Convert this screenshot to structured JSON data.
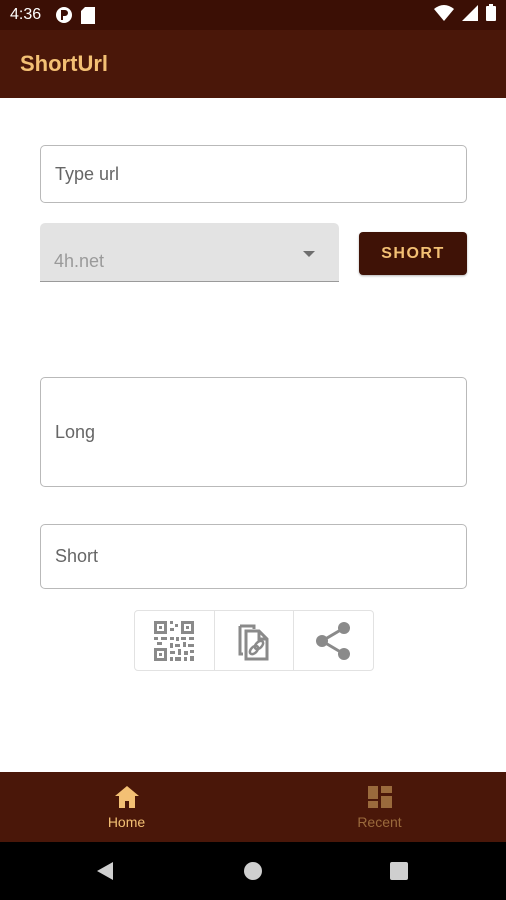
{
  "status_bar": {
    "time": "4:36",
    "icons_left": [
      "app-notification-icon",
      "sd-card-icon"
    ],
    "icons_right": [
      "wifi-icon",
      "signal-icon",
      "battery-icon"
    ]
  },
  "app_bar": {
    "title": "ShortUrl"
  },
  "form": {
    "url_placeholder": "Type url",
    "domain_selected": "4h.net",
    "short_button_label": "SHORT",
    "long_placeholder": "Long",
    "short_placeholder": "Short"
  },
  "actions": [
    {
      "name": "qr-code",
      "icon": "qr-code-icon"
    },
    {
      "name": "copy-link",
      "icon": "copy-link-icon"
    },
    {
      "name": "share",
      "icon": "share-icon"
    }
  ],
  "bottom_nav": {
    "items": [
      {
        "label": "Home",
        "icon": "home-icon",
        "active": true
      },
      {
        "label": "Recent",
        "icon": "dashboard-icon",
        "active": false
      }
    ]
  },
  "colors": {
    "status_bar_bg": "#3b0f05",
    "primary_dark": "#4a1709",
    "accent": "#f3c074",
    "inactive_nav": "#9a6a3c",
    "button_bg": "#3f1206"
  }
}
